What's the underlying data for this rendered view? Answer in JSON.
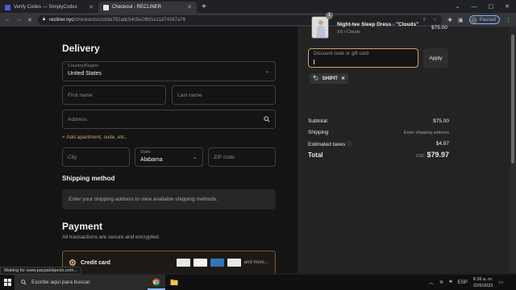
{
  "browser": {
    "tabs": [
      {
        "title": "Verify Codes — SimplyCodes",
        "active": false
      },
      {
        "title": "Checkout - RECLINER",
        "active": true
      }
    ],
    "new_tab": "+",
    "url_host": "recliner.nyc",
    "url_path": "/checkouts/c/cb3e762adc54c5e29bf1e11d74267a76",
    "profile_label": "Paused",
    "status_text": "Waiting for www.paypalobjects.com..."
  },
  "delivery": {
    "heading": "Delivery",
    "country_label": "Country/Region",
    "country_value": "United States",
    "first_name_placeholder": "First name",
    "last_name_placeholder": "Last name",
    "address_placeholder": "Address",
    "add_apartment": "+ Add apartment, suite, etc.",
    "city_placeholder": "City",
    "state_label": "State",
    "state_value": "Alabama",
    "zip_placeholder": "ZIP code"
  },
  "shipping": {
    "heading": "Shipping method",
    "message": "Enter your shipping address to view available shipping methods."
  },
  "payment": {
    "heading": "Payment",
    "subtitle": "All transactions are secure and encrypted.",
    "method_label": "Credit card",
    "more_label": "and more..."
  },
  "order": {
    "product_name": "Night-tee Sleep Dress - \"Clouds\"",
    "product_variant": "XS / Clouds",
    "product_price": "$75.00",
    "quantity_badge": "1",
    "discount_placeholder": "Discount code or gift card",
    "apply_label": "Apply",
    "applied_code": "SHIPIT",
    "subtotal_label": "Subtotal",
    "subtotal_value": "$75.00",
    "shipping_label": "Shipping",
    "shipping_value": "Enter shipping address",
    "taxes_label": "Estimated taxes",
    "taxes_value": "$4.97",
    "total_label": "Total",
    "total_currency": "USD",
    "total_value": "$79.97"
  },
  "taskbar": {
    "search_placeholder": "Escribe aquí para buscar.",
    "language": "ESP",
    "time": "6:26 a. m.",
    "date": "22/5/2023"
  },
  "colors": {
    "accent": "#c9a463",
    "page_bg": "#141414",
    "summary_bg": "#232323"
  }
}
